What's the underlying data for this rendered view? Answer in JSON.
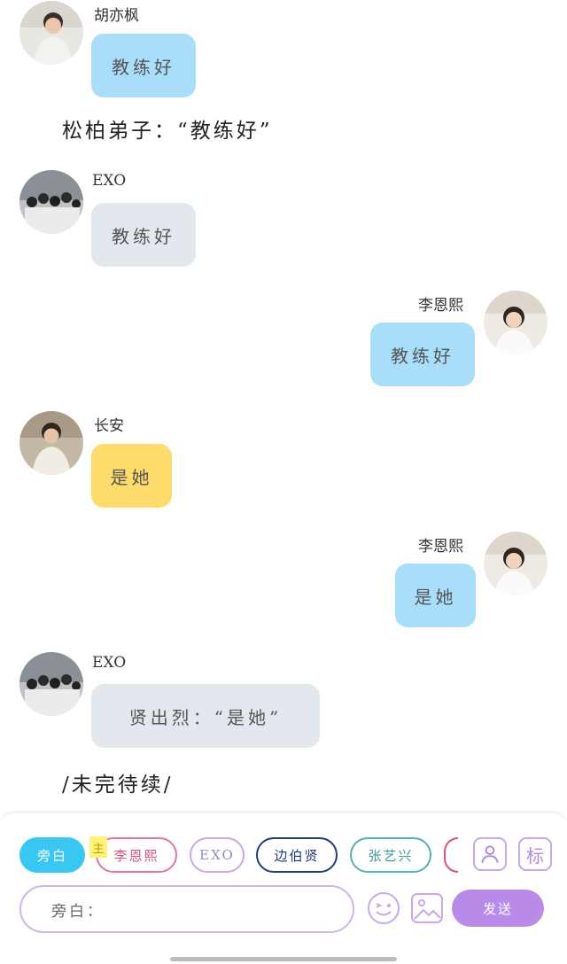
{
  "messages": [
    {
      "speaker": "胡亦枫",
      "text": "教练好"
    },
    {
      "narration": "松柏弟子：“教练好”"
    },
    {
      "speaker": "EXO",
      "text": "教练好"
    },
    {
      "speaker": "李恩熙",
      "text": "教练好"
    },
    {
      "speaker": "长安",
      "text": "是她"
    },
    {
      "speaker": "李恩熙",
      "text": "是她"
    },
    {
      "speaker": "EXO",
      "text": "贤出烈：“是她”"
    },
    {
      "narration": "/未完待续/"
    }
  ],
  "composer": {
    "chips": [
      "旁白",
      "李恩熙",
      "EXO",
      "边伯贤",
      "张艺兴"
    ],
    "main_tag": "主",
    "role_button": "person-icon",
    "mark_label": "标",
    "input_value": "旁白：",
    "send_label": "发送"
  },
  "colors": {
    "bubble_blue": "#a9defa",
    "bubble_gray": "#e3e8ef",
    "bubble_yellow": "#fddc6b",
    "chip_active": "#38c6f2",
    "accent_purple": "#b88be9"
  }
}
